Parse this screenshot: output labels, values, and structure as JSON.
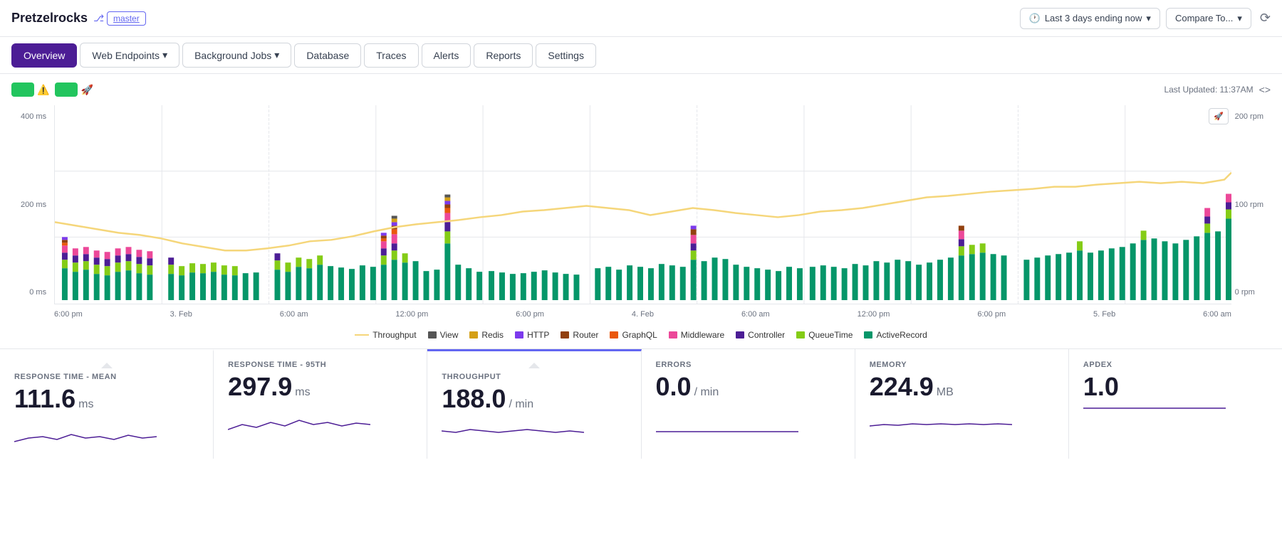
{
  "app": {
    "title": "Pretzelrocks",
    "branch": "master"
  },
  "header": {
    "time_label": "Last 3 days ending now",
    "compare_label": "Compare To...",
    "clock_icon": "🕐",
    "chevron": "▾",
    "refresh_icon": "↺"
  },
  "nav": {
    "items": [
      {
        "label": "Overview",
        "active": true,
        "dropdown": false
      },
      {
        "label": "Web Endpoints",
        "active": false,
        "dropdown": true
      },
      {
        "label": "Background Jobs",
        "active": false,
        "dropdown": true
      },
      {
        "label": "Database",
        "active": false,
        "dropdown": false
      },
      {
        "label": "Traces",
        "active": false,
        "dropdown": false
      },
      {
        "label": "Alerts",
        "active": false,
        "dropdown": false
      },
      {
        "label": "Reports",
        "active": false,
        "dropdown": false
      },
      {
        "label": "Settings",
        "active": false,
        "dropdown": false
      }
    ]
  },
  "toolbar": {
    "last_updated_label": "Last Updated: 11:37AM",
    "code_toggle": "<>"
  },
  "legend": {
    "items": [
      {
        "label": "Throughput",
        "color": "#f5d67a",
        "type": "line"
      },
      {
        "label": "View",
        "color": "#555555",
        "type": "bar"
      },
      {
        "label": "Redis",
        "color": "#d4a017",
        "type": "bar"
      },
      {
        "label": "HTTP",
        "color": "#7c3aed",
        "type": "bar"
      },
      {
        "label": "Router",
        "color": "#92400e",
        "type": "bar"
      },
      {
        "label": "GraphQL",
        "color": "#ea580c",
        "type": "bar"
      },
      {
        "label": "Middleware",
        "color": "#ec4899",
        "type": "bar"
      },
      {
        "label": "Controller",
        "color": "#4c1d95",
        "type": "bar"
      },
      {
        "label": "QueueTime",
        "color": "#84cc16",
        "type": "bar"
      },
      {
        "label": "ActiveRecord",
        "color": "#059669",
        "type": "bar"
      }
    ]
  },
  "y_axis_left": [
    "400 ms",
    "200 ms",
    "0 ms"
  ],
  "y_axis_right": [
    "200 rpm",
    "100 rpm",
    "0 rpm"
  ],
  "x_axis": [
    "6:00 pm",
    "3. Feb",
    "6:00 am",
    "12:00 pm",
    "6:00 pm",
    "4. Feb",
    "6:00 am",
    "12:00 pm",
    "6:00 pm",
    "5. Feb",
    "6:00 am"
  ],
  "metrics": [
    {
      "id": "response-time-mean",
      "label": "RESPONSE TIME - MEAN",
      "value": "111.6",
      "unit": "ms",
      "highlighted": false
    },
    {
      "id": "response-time-95th",
      "label": "RESPONSE TIME - 95TH",
      "value": "297.9",
      "unit": "ms",
      "highlighted": false
    },
    {
      "id": "throughput",
      "label": "THROUGHPUT",
      "value": "188.0",
      "unit": "/ min",
      "highlighted": true
    },
    {
      "id": "errors",
      "label": "ERRORS",
      "value": "0.0",
      "unit": "/ min",
      "highlighted": false
    },
    {
      "id": "memory",
      "label": "MEMORY",
      "value": "224.9",
      "unit": "MB",
      "highlighted": false
    },
    {
      "id": "apdex",
      "label": "APDEX",
      "value": "1.0",
      "unit": "",
      "highlighted": false
    }
  ]
}
